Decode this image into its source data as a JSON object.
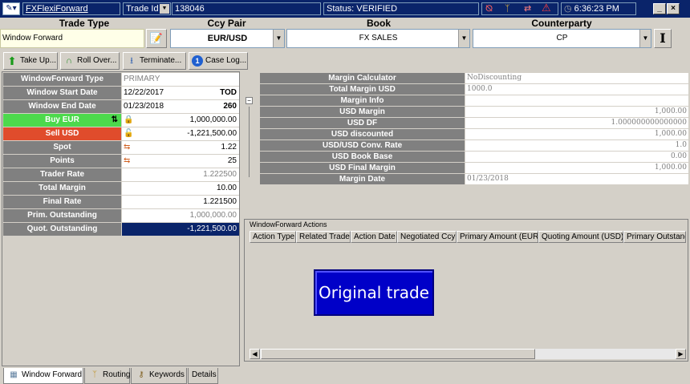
{
  "titlebar": {
    "app_link": "FXFlexiForward",
    "trade_id_label": "Trade Id",
    "trade_id_value": "138046",
    "status": "Status: VERIFIED",
    "time": "6:36:23 PM"
  },
  "header": {
    "trade_type_label": "Trade Type",
    "ccy_pair_label": "Ccy Pair",
    "book_label": "Book",
    "counterparty_label": "Counterparty",
    "trade_type_value": "Window Forward",
    "ccy_pair_value": "EUR/USD",
    "book_value": "FX SALES",
    "counterparty_value": "CP"
  },
  "toolbar": {
    "take_up": "Take Up...",
    "roll_over": "Roll Over...",
    "terminate": "Terminate...",
    "case_log": "Case Log...",
    "case_log_badge": "1"
  },
  "left": {
    "type_label": "WindowForward Type",
    "type_value": "PRIMARY",
    "start_label": "Window Start Date",
    "start_value": "12/22/2017",
    "start_tenor": "TOD",
    "end_label": "Window End Date",
    "end_value": "01/23/2018",
    "end_days": "260",
    "buy_label": "Buy EUR",
    "buy_value": "1,000,000.00",
    "sell_label": "Sell USD",
    "sell_value": "-1,221,500.00",
    "spot_label": "Spot",
    "spot_value": "1.22",
    "points_label": "Points",
    "points_value": "25",
    "trader_rate_label": "Trader Rate",
    "trader_rate_value": "1.222500",
    "total_margin_label": "Total Margin",
    "total_margin_value": "10.00",
    "final_rate_label": "Final Rate",
    "final_rate_value": "1.221500",
    "prim_out_label": "Prim. Outstanding",
    "prim_out_value": "1,000,000.00",
    "quot_out_label": "Quot. Outstanding",
    "quot_out_value": "-1,221,500.00"
  },
  "margin": {
    "calc_label": "Margin Calculator",
    "calc_value": "NoDiscounting",
    "total_label": "Total Margin USD",
    "total_value": "1000.0",
    "info_label": "Margin Info",
    "usd_margin_label": "USD Margin",
    "usd_margin_value": "1,000.00",
    "usd_df_label": "USD DF",
    "usd_df_value": "1.000000000000000",
    "usd_disc_label": "USD discounted",
    "usd_disc_value": "1,000.00",
    "conv_label": "USD/USD Conv. Rate",
    "conv_value": "1.0",
    "book_base_label": "USD Book Base",
    "book_base_value": "0.00",
    "final_label": "USD Final Margin",
    "final_value": "1,000.00",
    "date_label": "Margin Date",
    "date_value": "01/23/2018"
  },
  "actions": {
    "legend": "WindowForward Actions",
    "columns": [
      "Action Type",
      "Related Trade",
      "Action Date",
      "Negotiated Ccy",
      "Primary Amount (EUR)",
      "Quoting Amount (USD)",
      "Primary Outstanding"
    ],
    "original_trade_button": "Original trade"
  },
  "tabs": [
    "Window Forward",
    "Routing",
    "Keywords",
    "Details"
  ],
  "colors": {
    "buy": "#4cd94c",
    "sell": "#e04c2c",
    "titlebar": "#0a246a",
    "selected_value": "#0a246a"
  }
}
